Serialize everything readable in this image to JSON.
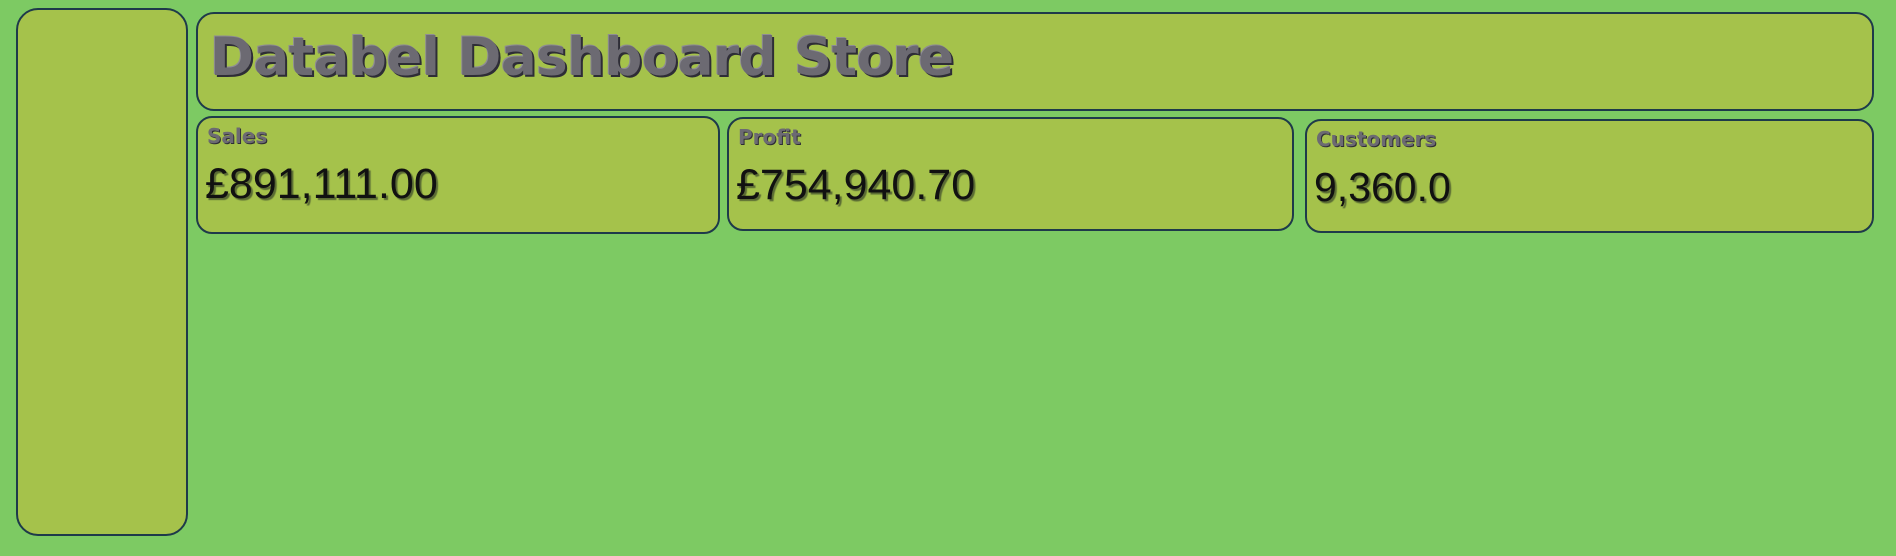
{
  "title": "Databel Dashboard Store",
  "kpis": [
    {
      "label": "Sales",
      "value": "£891,111.00"
    },
    {
      "label": "Profit",
      "value": "£754,940.70"
    },
    {
      "label": "Customers",
      "value": "9,360.0"
    }
  ],
  "colors": {
    "background": "#7dca63",
    "panel": "#a5c24b",
    "border": "#1e3a4a",
    "label_text": "#6c6a72",
    "value_text": "#111111"
  }
}
